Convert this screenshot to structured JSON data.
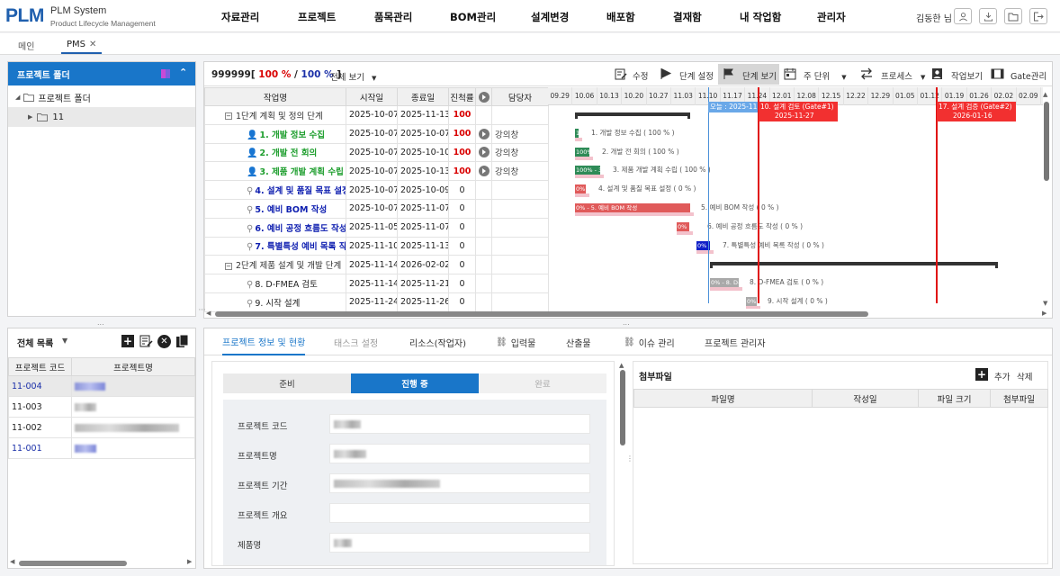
{
  "app": {
    "logo": "PLM",
    "name": "PLM System",
    "subtitle": "Product Lifecycle Management"
  },
  "menu": [
    "자료관리",
    "프로젝트",
    "품목관리",
    "BOM관리",
    "설계변경",
    "배포함",
    "결재함",
    "내 작업함",
    "관리자"
  ],
  "user": {
    "name": "김동한 님"
  },
  "header_icons": [
    "user-icon",
    "download-icon",
    "folder-icon",
    "logout-icon"
  ],
  "page_tabs": [
    {
      "label": "메인",
      "active": false
    },
    {
      "label": "PMS",
      "active": true
    }
  ],
  "folder_panel": {
    "title": "프로젝트 폴더",
    "root": "프로젝트 폴더",
    "child": "11"
  },
  "project_list": {
    "title": "전체 목록",
    "columns": [
      "프로젝트 코드",
      "프로젝트명"
    ],
    "rows": [
      {
        "code": "11-004",
        "blue": true
      },
      {
        "code": "11-003",
        "blue": false
      },
      {
        "code": "11-002",
        "blue": false
      },
      {
        "code": "11-001",
        "blue": true
      }
    ]
  },
  "gantt": {
    "project_label": "999999[",
    "progress_a": "100 %",
    "slash": "/",
    "progress_b": "100 %",
    "close": "]",
    "view_select": "전체 보기",
    "toolbar": {
      "edit": "수정",
      "stage_set": "단계 설정",
      "stage_view": "단계 보기",
      "unit": "주 단위",
      "process": "프로세스",
      "work_view": "작업보기",
      "gate": "Gate관리"
    },
    "columns": [
      "작업명",
      "시작일",
      "종료일",
      "진척률",
      "담당자"
    ],
    "rows": [
      {
        "name": "1단계 계획 및 정의 단계",
        "start": "2025-10-07",
        "end": "2025-11-13",
        "progress": "100",
        "owner": "",
        "kind": "group",
        "play": false
      },
      {
        "name": "1. 개발 정보 수집",
        "start": "2025-10-07",
        "end": "2025-10-07",
        "progress": "100",
        "owner": "강의창",
        "kind": "green",
        "play": true
      },
      {
        "name": "2. 개발 전 회의",
        "start": "2025-10-07",
        "end": "2025-10-10",
        "progress": "100",
        "owner": "강의창",
        "kind": "green",
        "play": true
      },
      {
        "name": "3. 제품 개발 계획 수립",
        "start": "2025-10-07",
        "end": "2025-10-13",
        "progress": "100",
        "owner": "강의창",
        "kind": "green",
        "play": true
      },
      {
        "name": "4. 설계 및 품질 목표 설정",
        "start": "2025-10-07",
        "end": "2025-10-09",
        "progress": "0",
        "owner": "",
        "kind": "blue",
        "play": false
      },
      {
        "name": "5. 예비 BOM 작성",
        "start": "2025-10-07",
        "end": "2025-11-07",
        "progress": "0",
        "owner": "",
        "kind": "blue",
        "play": false
      },
      {
        "name": "6. 예비 공정 흐름도 작성",
        "start": "2025-11-05",
        "end": "2025-11-07",
        "progress": "0",
        "owner": "",
        "kind": "blue",
        "play": false
      },
      {
        "name": "7. 특별특성 예비 목록 작성",
        "start": "2025-11-10",
        "end": "2025-11-13",
        "progress": "0",
        "owner": "",
        "kind": "blue",
        "play": false
      },
      {
        "name": "2단계 제품 설계 및 개발 단계",
        "start": "2025-11-14",
        "end": "2026-02-02",
        "progress": "0",
        "owner": "",
        "kind": "group",
        "play": false
      },
      {
        "name": "8. D-FMEA 검토",
        "start": "2025-11-14",
        "end": "2025-11-21",
        "progress": "0",
        "owner": "",
        "kind": "plain",
        "play": false
      },
      {
        "name": "9. 시작 설계",
        "start": "2025-11-24",
        "end": "2025-11-26",
        "progress": "0",
        "owner": "",
        "kind": "plain",
        "play": false
      }
    ],
    "dates": [
      "09.29",
      "10.06",
      "10.13",
      "10.20",
      "10.27",
      "11.03",
      "11.10",
      "11.17",
      "11.24",
      "12.01",
      "12.08",
      "12.15",
      "12.22",
      "12.29",
      "01.05",
      "01.12",
      "01.19",
      "01.26",
      "02.02",
      "02.09"
    ],
    "bars": [
      {
        "label": "1. 개발 정보 수집 ( 100 % )",
        "text": "1",
        "color": "#2e8b57"
      },
      {
        "label": "2. 개발 전 회의 ( 100 % )",
        "text": "100%",
        "color": "#2e8b57"
      },
      {
        "label": "3. 제품 개발 계획 수립 ( 100 % )",
        "text": "100% - 3",
        "color": "#2e8b57"
      },
      {
        "label": "4. 설계 및 품질 목표 설정 ( 0 % )",
        "text": "0%",
        "color": "#e05a5a"
      },
      {
        "label": "5. 예비 BOM 작성 ( 0 % )",
        "text": "0% - 5. 예비 BOM 작성",
        "color": "#e05a5a"
      },
      {
        "label": "6. 예비 공정 흐름도 작성 ( 0 % )",
        "text": "0%",
        "color": "#e05a5a"
      },
      {
        "label": "7. 특별특성 예비 목록 작성 ( 0 % )",
        "text": "0%",
        "color": "#1020c8"
      },
      {
        "label": "8. D-FMEA 검토 ( 0 % )",
        "text": "0% - 8. D-",
        "color": "#a9a9a9"
      },
      {
        "label": "9. 시작 설계 ( 0 % )",
        "text": "0%",
        "color": "#a9a9a9"
      }
    ],
    "markers": {
      "today": "오늘 : 2025-11",
      "gate1_a": "10. 설계 검토 (Gate#1)",
      "gate1_b": "2025-11-27",
      "gate2_a": "17. 설계 검증 (Gate#2)",
      "gate2_b": "2026-01-16"
    }
  },
  "detail_tabs": [
    {
      "label": "프로젝트 정보 및 현황",
      "active": true,
      "icon": false,
      "dim": false
    },
    {
      "label": "태스크 설정",
      "active": false,
      "icon": false,
      "dim": true
    },
    {
      "label": "리소스(작업자)",
      "active": false,
      "icon": false,
      "dim": false
    },
    {
      "label": "입력물",
      "active": false,
      "icon": true,
      "dim": false
    },
    {
      "label": "산출물",
      "active": false,
      "icon": false,
      "dim": false
    },
    {
      "label": "이슈 관리",
      "active": false,
      "icon": true,
      "dim": false
    },
    {
      "label": "프로젝트 관리자",
      "active": false,
      "icon": false,
      "dim": false
    }
  ],
  "status_steps": [
    "준비",
    "진행 중",
    "완료"
  ],
  "form_labels": [
    "프로젝트 코드",
    "프로젝트명",
    "프로젝트 기간",
    "프로젝트 개요",
    "제품명"
  ],
  "attach": {
    "title": "첨부파일",
    "add": "추가",
    "delete": "삭제",
    "columns": [
      "파일명",
      "작성일",
      "파일 크기",
      "첨부파일"
    ]
  }
}
